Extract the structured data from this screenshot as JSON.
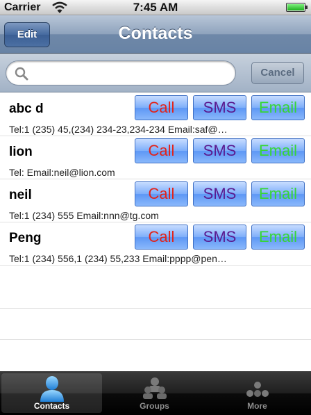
{
  "status_bar": {
    "carrier": "Carrier",
    "time": "7:45 AM"
  },
  "nav": {
    "edit_label": "Edit",
    "title": "Contacts"
  },
  "search": {
    "placeholder": "",
    "value": "",
    "cancel_label": "Cancel"
  },
  "contacts": [
    {
      "name": "abc d",
      "detail": "Tel:1 (235) 45,(234) 234-23,234-234  Email:saf@…",
      "call": "Call",
      "sms": "SMS",
      "email": "Email"
    },
    {
      "name": "lion",
      "detail": "Tel:  Email:neil@lion.com",
      "call": "Call",
      "sms": "SMS",
      "email": "Email"
    },
    {
      "name": "neil",
      "detail": "Tel:1 (234) 555  Email:nnn@tg.com",
      "call": "Call",
      "sms": "SMS",
      "email": "Email"
    },
    {
      "name": "Peng",
      "detail": "Tel:1 (234) 556,1 (234) 55,233  Email:pppp@pen…",
      "call": "Call",
      "sms": "SMS",
      "email": "Email"
    }
  ],
  "tabs": [
    {
      "label": "Contacts",
      "icon": "person-icon",
      "active": true
    },
    {
      "label": "Groups",
      "icon": "group-icon",
      "active": false
    },
    {
      "label": "More",
      "icon": "more-icon",
      "active": false
    }
  ],
  "colors": {
    "call_text": "#e2231a",
    "sms_text": "#5a1a8f",
    "email_text": "#36d636",
    "nav_bar": "#6f88a8",
    "active_tab_icon": "#3aa0f0"
  }
}
